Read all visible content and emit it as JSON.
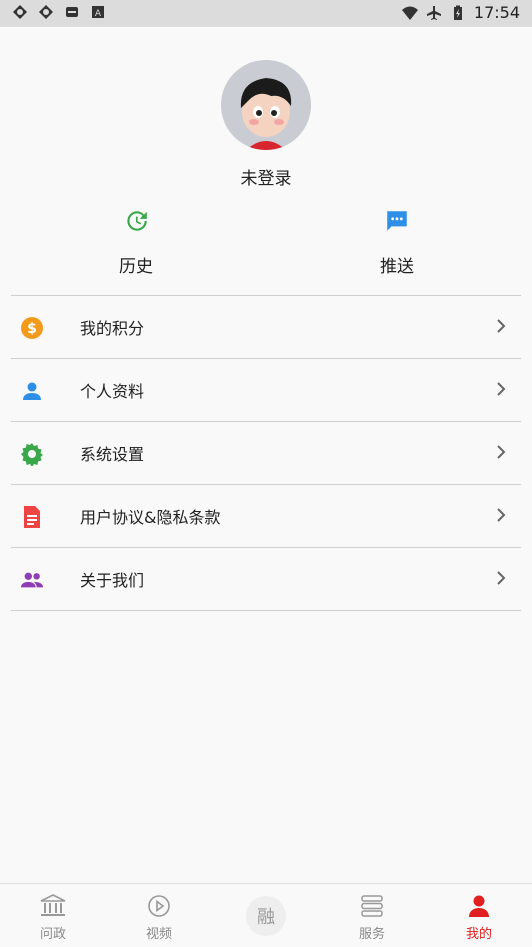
{
  "status_bar": {
    "time": "17:54"
  },
  "profile": {
    "login_status": "未登录"
  },
  "quick_actions": [
    {
      "label": "历史",
      "icon": "history-icon",
      "color": "#3aa84a"
    },
    {
      "label": "推送",
      "icon": "message-icon",
      "color": "#2d8fe6"
    }
  ],
  "menu": [
    {
      "label": "我的积分",
      "icon": "dollar-icon",
      "color": "#f39a1b"
    },
    {
      "label": "个人资料",
      "icon": "person-icon",
      "color": "#2d8fe6"
    },
    {
      "label": "系统设置",
      "icon": "gear-icon",
      "color": "#3aa84a"
    },
    {
      "label": "用户协议&隐私条款",
      "icon": "document-icon",
      "color": "#ee4444"
    },
    {
      "label": "关于我们",
      "icon": "group-icon",
      "color": "#8e3db5"
    }
  ],
  "tabs": [
    {
      "label": "问政",
      "icon": "building-icon"
    },
    {
      "label": "视频",
      "icon": "play-icon"
    },
    {
      "label": "融",
      "icon": "center-logo"
    },
    {
      "label": "服务",
      "icon": "list-icon"
    },
    {
      "label": "我的",
      "icon": "person-icon",
      "active": true
    }
  ],
  "colors": {
    "accent": "#e02020",
    "inactive": "#888888"
  }
}
